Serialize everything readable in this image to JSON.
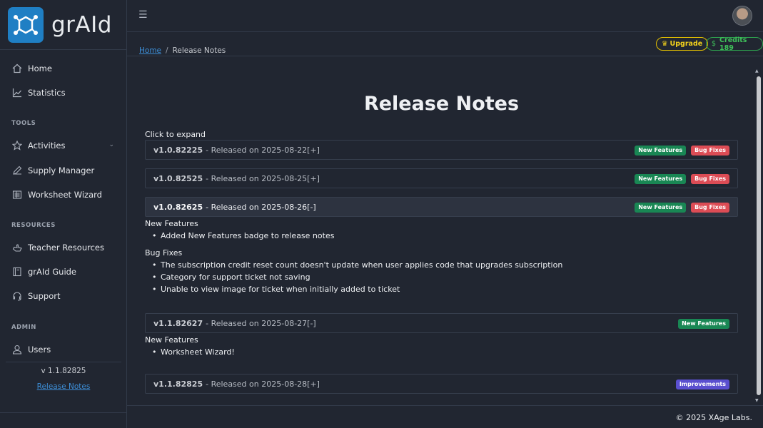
{
  "brand": {
    "name": "grAId",
    "accent": "#1f7fc4"
  },
  "sidebar": {
    "items": [
      {
        "label": "Home",
        "icon": "home-icon"
      },
      {
        "label": "Statistics",
        "icon": "chart-line-icon"
      }
    ],
    "tools_header": "TOOLS",
    "tools": [
      {
        "label": "Activities",
        "icon": "star-icon"
      },
      {
        "label": "Supply Manager",
        "icon": "pencil-icon"
      },
      {
        "label": "Worksheet Wizard",
        "icon": "worksheet-icon"
      }
    ],
    "resources_header": "RESOURCES",
    "resources": [
      {
        "label": "Teacher Resources",
        "icon": "hand-icon"
      },
      {
        "label": "grAId Guide",
        "icon": "book-icon"
      },
      {
        "label": "Support",
        "icon": "headset-icon"
      }
    ],
    "admin_header": "ADMIN",
    "admin": [
      {
        "label": "Users",
        "icon": "user-icon"
      }
    ],
    "version": "v 1.1.82825",
    "release_notes_link": "Release Notes"
  },
  "header": {
    "menu_icon": "hamburger-icon",
    "avatar": "user-avatar"
  },
  "subheader": {
    "breadcrumb_home": "Home",
    "breadcrumb_sep": "/",
    "breadcrumb_current": "Release Notes",
    "upgrade_label": "Upgrade",
    "credits_label": "Credits 189"
  },
  "main": {
    "title": "Release Notes",
    "hint": "Click to expand",
    "releases": [
      {
        "version": "v1.0.82225",
        "text": " - Released on 2025-08-22[+]",
        "badges": [
          "New Features",
          "Bug Fixes"
        ]
      },
      {
        "version": "v1.0.82525",
        "text": " - Released on 2025-08-25[+]",
        "badges": [
          "New Features",
          "Bug Fixes"
        ]
      },
      {
        "version": "v1.0.82625",
        "text": " - Released on 2025-08-26[-]",
        "badges": [
          "New Features",
          "Bug Fixes"
        ],
        "sections": [
          {
            "title": "New Features",
            "items": [
              "Added New Features badge to release notes"
            ]
          },
          {
            "title": "Bug Fixes",
            "items": [
              "The subscription credit reset count doesn't update when user applies code that upgrades subscription",
              "Category for support ticket not saving",
              "Unable to view image for ticket when initially added to ticket"
            ]
          }
        ]
      },
      {
        "version": "v1.1.82627",
        "text": " - Released on 2025-08-27[-]",
        "badges": [
          "New Features"
        ],
        "sections": [
          {
            "title": "New Features",
            "items": [
              "Worksheet Wizard!"
            ]
          }
        ]
      },
      {
        "version": "v1.1.82825",
        "text": " - Released on 2025-08-28[+]",
        "badges": [
          "Improvements"
        ]
      }
    ]
  },
  "footer": {
    "copyright": "© 2025 XAge Labs."
  },
  "colors": {
    "new_features": "#198754",
    "bug_fixes": "#dc4c55",
    "improvements": "#5a4fcf"
  }
}
